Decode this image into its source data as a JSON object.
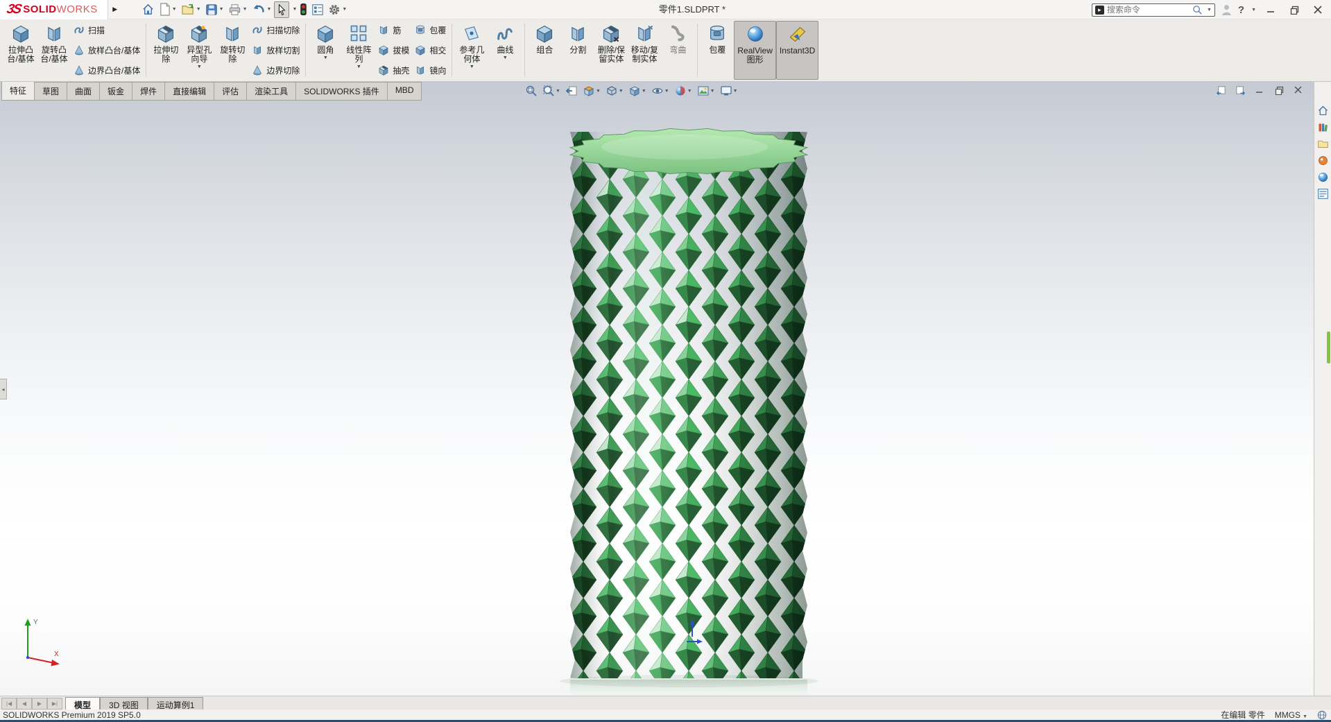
{
  "titlebar": {
    "brand_glyph": "3S",
    "brand_bold": "SOLID",
    "brand_light": "WORKS",
    "doc_title": "零件1.SLDPRT *",
    "search_placeholder": "搜索命令",
    "help_label": "?"
  },
  "titlebar_icons": [
    "home",
    "new-document",
    "open",
    "save",
    "print",
    "undo",
    "select-cursor",
    "selection-traffic-light",
    "options-list",
    "settings-gear",
    "user",
    "help",
    "minimize",
    "restore",
    "close"
  ],
  "ribbon": {
    "extruded_boss": {
      "l1": "拉伸凸",
      "l2": "台/基体"
    },
    "revolved_boss": {
      "l1": "旋转凸",
      "l2": "台/基体"
    },
    "swept_boss": "扫描",
    "lofted_boss": "放样凸台/基体",
    "boundary_boss": "边界凸台/基体",
    "extruded_cut": {
      "l1": "拉伸切",
      "l2": "除"
    },
    "hole_wizard": {
      "l1": "异型孔",
      "l2": "向导"
    },
    "revolved_cut": {
      "l1": "旋转切",
      "l2": "除"
    },
    "swept_cut": "扫描切除",
    "lofted_cut": "放样切割",
    "boundary_cut": "边界切除",
    "fillet": "圆角",
    "linear_pattern": {
      "l1": "线性阵",
      "l2": "列"
    },
    "rib": "筋",
    "draft": "拔模",
    "shell": "抽壳",
    "wrap": "包覆",
    "intersect": "相交",
    "mirror": "镜向",
    "reference_geometry": {
      "l1": "参考几",
      "l2": "何体"
    },
    "curves": "曲线",
    "combine": "组合",
    "split": "分割",
    "delete_keep_body": {
      "l1": "删除/保",
      "l2": "留实体"
    },
    "move_copy_body": {
      "l1": "移动/复",
      "l2": "制实体"
    },
    "flex": "弯曲",
    "wrap2": "包覆",
    "realview": {
      "l1": "RealView",
      "l2": "图形"
    },
    "instant3d": "Instant3D"
  },
  "command_tabs": [
    "特征",
    "草图",
    "曲面",
    "钣金",
    "焊件",
    "直接编辑",
    "评估",
    "渲染工具",
    "SOLIDWORKS 插件",
    "MBD"
  ],
  "headsup_icons": [
    "zoom-to-fit",
    "zoom-to-area",
    "previous-view",
    "section-view",
    "view-orientation",
    "display-style",
    "hide-show-items",
    "edit-appearance",
    "apply-scene",
    "view-settings"
  ],
  "doc_window_icons": [
    "window-previous",
    "window-next",
    "minimize-document",
    "restore-document",
    "close-document"
  ],
  "taskpane_icons": [
    "home",
    "design-library",
    "file-explorer",
    "view-palette",
    "appearances-scenes",
    "custom-properties"
  ],
  "doc_tabs": [
    "模型",
    "3D 视图",
    "运动算例1"
  ],
  "nav_icons": [
    "first-tab",
    "previous-tab",
    "next-tab",
    "last-tab"
  ],
  "statusbar": {
    "product": "SOLIDWORKS Premium 2019 SP5.0",
    "editing_mode": "在编辑 零件",
    "units": "MMGS"
  },
  "triad": {
    "x_label": "X",
    "y_label": "Y"
  },
  "model": {
    "description": "green faceted column with diamond pyramid texture and light-green scalloped top cap",
    "cap_color": "#9ade9e",
    "facet_dark": "#1c5430",
    "facet_light": "#bfe9c4"
  },
  "colors": {
    "accent_red": "#d6001c",
    "pressed_button_bg": "#c7c4c1",
    "green_scroll_thumb": "#86c440",
    "status_strip": "#2d4b6e"
  }
}
